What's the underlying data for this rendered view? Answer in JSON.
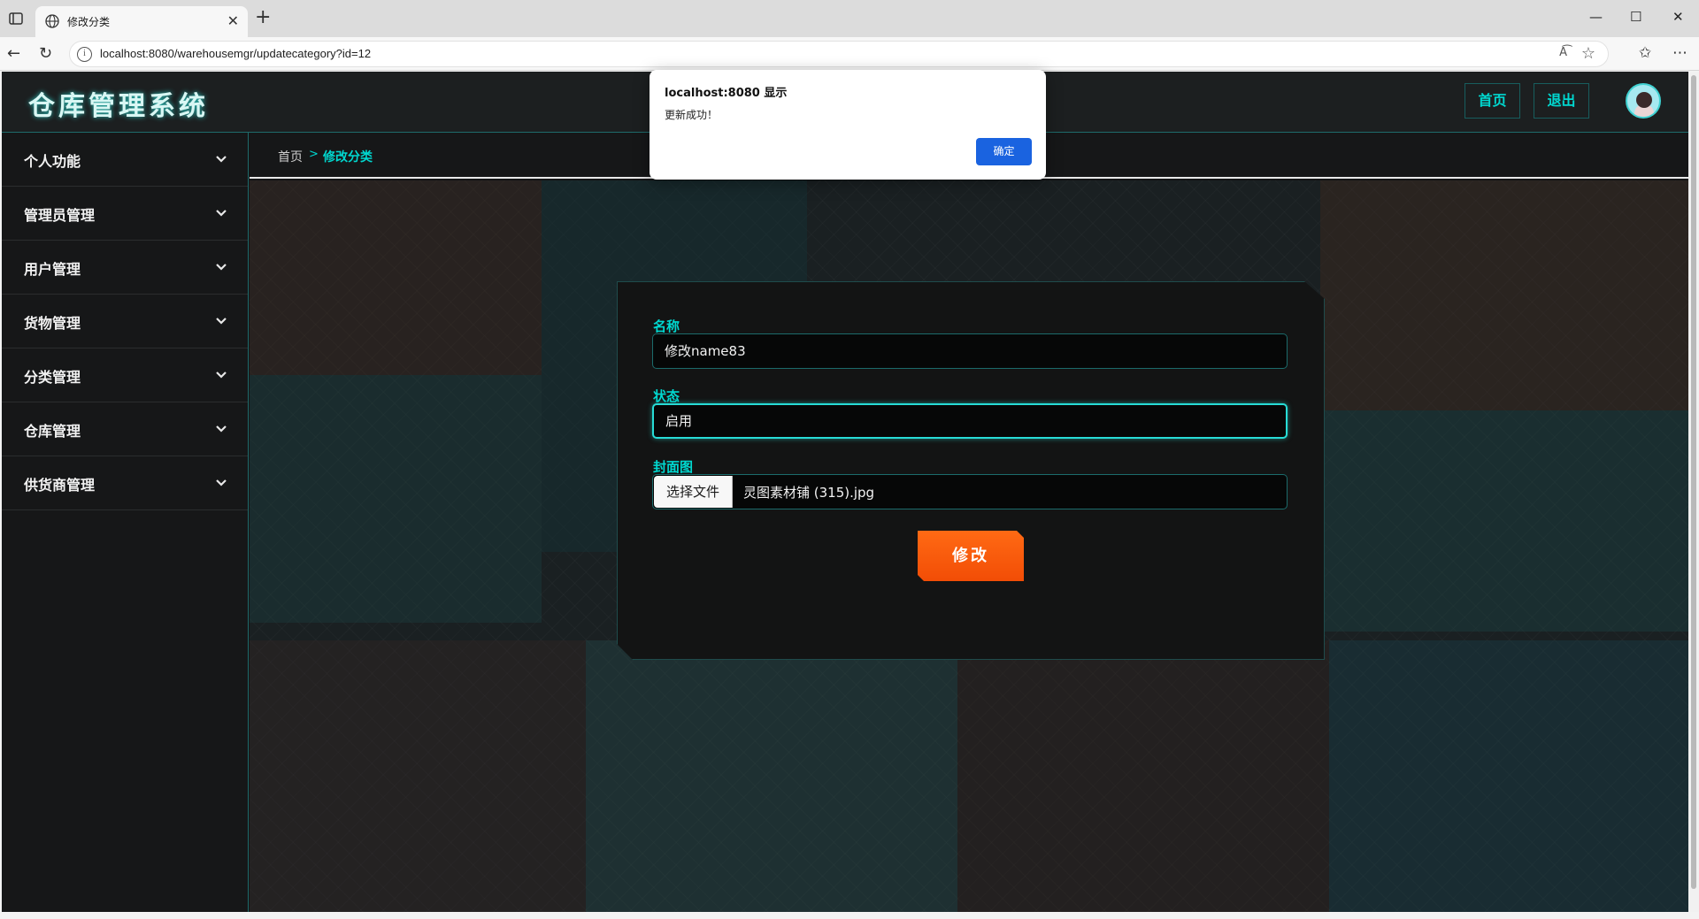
{
  "browser": {
    "tab_title": "修改分类",
    "url": "localhost:8080/warehousemgr/updatecategory?id=12",
    "read_aloud_label": "A͡"
  },
  "header": {
    "logo": "仓库管理系统",
    "home_label": "首页",
    "logout_label": "退出"
  },
  "sidebar": {
    "items": [
      {
        "label": "个人功能"
      },
      {
        "label": "管理员管理"
      },
      {
        "label": "用户管理"
      },
      {
        "label": "货物管理"
      },
      {
        "label": "分类管理"
      },
      {
        "label": "仓库管理"
      },
      {
        "label": "供货商管理"
      }
    ]
  },
  "breadcrumb": {
    "home": "首页",
    "separator": ">",
    "current": "修改分类"
  },
  "form": {
    "name_label": "名称",
    "name_value": "修改name83",
    "status_label": "状态",
    "status_value": "启用",
    "cover_label": "封面图",
    "file_button": "选择文件",
    "file_name": "灵图素材铺 (315).jpg",
    "submit_label": "修改"
  },
  "dialog": {
    "title": "localhost:8080 显示",
    "message": "更新成功！",
    "ok_label": "确定"
  },
  "colors": {
    "accent": "#00d8d0",
    "button": "#f24d06",
    "dialog_ok": "#1a63e0"
  }
}
